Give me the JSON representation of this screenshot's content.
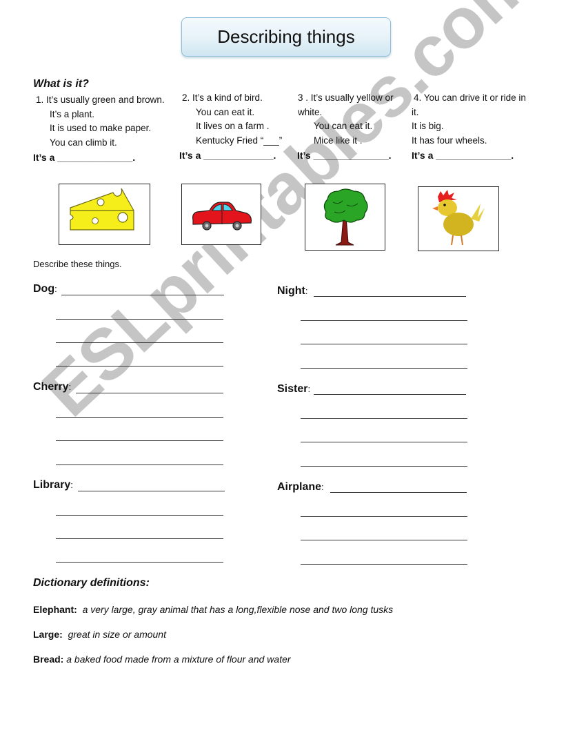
{
  "title": "Describing things",
  "what_is_it": {
    "heading": "What is it?",
    "riddles": [
      {
        "lines": [
          "1.  It’s usually green and brown.",
          "It’s a plant.",
          "It is used to make paper.",
          "You can climb it."
        ],
        "answer": "It’s a ______________."
      },
      {
        "lines": [
          "2.  It’s a kind of bird.",
          "You can eat it.",
          "It lives on a farm .",
          "Kentucky Fried “___”"
        ],
        "answer": "It’s a  _____________."
      },
      {
        "lines": [
          "3 .  It’s usually yellow or",
          "white.",
          "You can eat it.",
          "Mice like it ."
        ],
        "answer": "It’s  ______________."
      },
      {
        "lines": [
          "4.  You can drive it or ride in",
          "it.",
          "It is big.",
          "It has four wheels."
        ],
        "answer": "It’s a ______________."
      }
    ],
    "pictures": [
      {
        "icon": "cheese-icon"
      },
      {
        "icon": "car-icon"
      },
      {
        "icon": "tree-icon"
      },
      {
        "icon": "chicken-icon"
      }
    ]
  },
  "describe": {
    "instruction": "Describe these things.",
    "items": [
      {
        "word": "Dog",
        "colon": ":"
      },
      {
        "word": "Night",
        "colon": ":"
      },
      {
        "word": "Cherry",
        "colon": ":"
      },
      {
        "word": "Sister",
        "colon": ":"
      },
      {
        "word": "Library",
        "colon": ":"
      },
      {
        "word": "Airplane",
        "colon": ":"
      }
    ]
  },
  "dictionary": {
    "heading": "Dictionary definitions:",
    "entries": [
      {
        "term": "Elephant:",
        "definition": "a very large, gray animal that has a long,flexible nose and two long tusks"
      },
      {
        "term": "Large:",
        "definition": "great in size or amount"
      },
      {
        "term": "Bread:",
        "definition": "a baked food made from a mixture of flour and water"
      }
    ]
  },
  "watermark": "ESLprintables.com"
}
